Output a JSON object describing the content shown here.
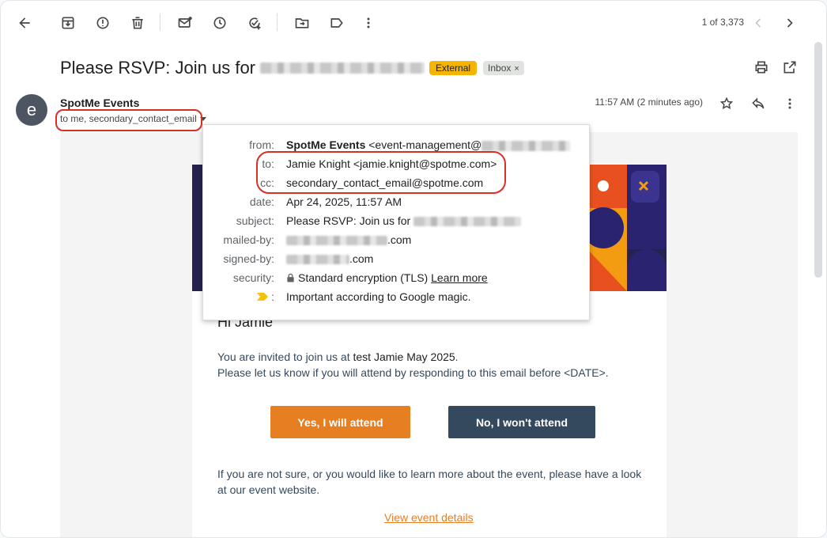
{
  "toolbar": {
    "pager": "1 of 3,373",
    "icons": [
      "back-arrow-icon",
      "archive-icon",
      "report-spam-icon",
      "delete-icon",
      "mark-unread-icon",
      "snooze-icon",
      "add-to-tasks-icon",
      "move-to-icon",
      "labels-icon",
      "more-vert-icon",
      "prev-chevron-icon",
      "next-chevron-icon"
    ]
  },
  "message": {
    "subject": "Please RSVP: Join us for",
    "labels": {
      "external": "External",
      "inbox": "Inbox",
      "remove": "×"
    },
    "sender_initial": "e",
    "sender_name": "SpotMe Events",
    "to_line": "to me, secondary_contact_email",
    "time": "11:57 AM (2 minutes ago)"
  },
  "details": {
    "from_label": "from:",
    "from_name": "SpotMe Events",
    "from_email": "<event-management@",
    "to_label": "to:",
    "to_value": "Jamie Knight <jamie.knight@spotme.com>",
    "cc_label": "cc:",
    "cc_value": "secondary_contact_email@spotme.com",
    "date_label": "date:",
    "date_value": "Apr 24, 2025, 11:57 AM",
    "subject_label": "subject:",
    "subject_value": "Please RSVP: Join us for",
    "mailedby_label": "mailed-by:",
    "mailedby_value": ".com",
    "signedby_label": "signed-by:",
    "signedby_value": ".com",
    "security_label": "security:",
    "security_value": "Standard encryption (TLS)",
    "security_link": "Learn more",
    "importance_sep": ":",
    "importance_value": "Important according to Google magic."
  },
  "email": {
    "greeting": "Hi Jamie",
    "invite_prefix": "You are invited to join us at ",
    "event_name": "test Jamie May 2025",
    "invite_suffix": ".",
    "invite_line2": "Please let us know if you will attend by responding to this email before <DATE>.",
    "yes_button": "Yes, I will attend",
    "no_button": "No, I won't attend",
    "unsure_text": "If you are not sure, or you would like to learn more about the event, please have a look at our event website.",
    "view_link": "View event details"
  },
  "colors": {
    "accent_orange": "#e67e22",
    "dark_button": "#34495e",
    "external_badge": "#f4b400",
    "annotation_red": "#d93025",
    "banner_navy": "#25224f"
  }
}
